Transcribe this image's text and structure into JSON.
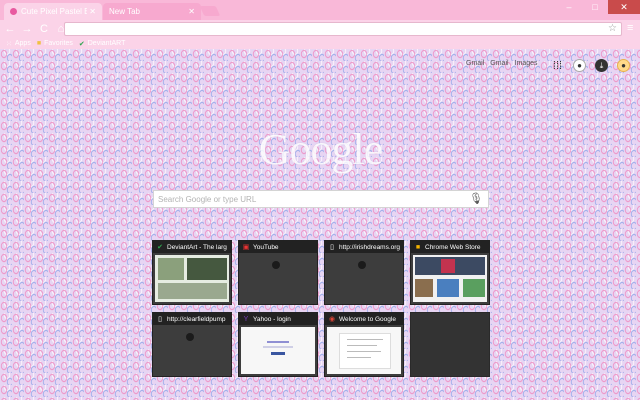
{
  "tabs": [
    {
      "title": "Cute Pixel Pastel Easter",
      "active": true
    },
    {
      "title": "New Tab",
      "active": false
    }
  ],
  "window_controls": {
    "minimize": "–",
    "maximize": "□",
    "close": "✕"
  },
  "toolbar": {
    "back": "←",
    "forward": "→",
    "reload": "C",
    "home": "⌂",
    "star": "☆",
    "menu": "≡"
  },
  "bookmarks": [
    {
      "icon": "apps-icon",
      "label": "Apps"
    },
    {
      "icon": "folder-icon",
      "label": "Favorites"
    },
    {
      "icon": "deviantart-icon",
      "label": "DeviantART"
    }
  ],
  "top_links": [
    "Gmail",
    "Gmail",
    "Images"
  ],
  "search": {
    "placeholder": "Search Google or type URL"
  },
  "logo_text": "Google",
  "tiles": [
    {
      "title": "DeviantArt - The larg",
      "icon": "deviantart-icon",
      "preview": "screenshot"
    },
    {
      "title": "YouTube",
      "icon": "youtube-icon",
      "preview": "blank"
    },
    {
      "title": "http://irishdreams.org",
      "icon": "page-icon",
      "preview": "blank"
    },
    {
      "title": "Chrome Web Store",
      "icon": "chrome-store-icon",
      "preview": "screenshot"
    },
    {
      "title": "http://clearfieldpump",
      "icon": "page-icon",
      "preview": "blank"
    },
    {
      "title": "Yahoo - login",
      "icon": "yahoo-icon",
      "preview": "screenshot"
    },
    {
      "title": "Welcome to Google",
      "icon": "chrome-icon",
      "preview": "screenshot"
    },
    {
      "title": "",
      "icon": "",
      "preview": "empty"
    }
  ],
  "colors": {
    "theme_pink": "#f9b8d8",
    "toolbar_pink": "#fbd3e8",
    "tile_dark": "#3d3d3d"
  }
}
